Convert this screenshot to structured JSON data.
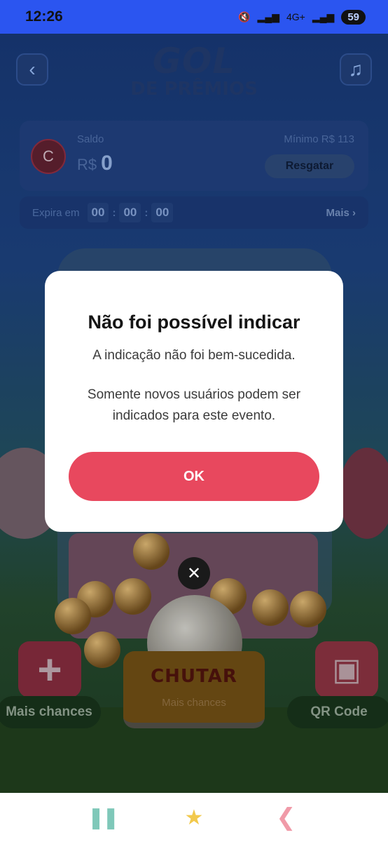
{
  "status_bar": {
    "time": "12:26",
    "network": "4G+",
    "battery": "59"
  },
  "game": {
    "title_line1": "GOL",
    "title_line2": "DE PRÊMIOS",
    "back_icon": "chevron-left-icon",
    "music_icon": "music-note-icon"
  },
  "balance": {
    "avatar_letter": "C",
    "label": "Saldo",
    "currency": "R$",
    "amount": "0",
    "minimum": "Mínimo  R$ 113",
    "redeem_label": "Resgatar"
  },
  "expiry": {
    "label": "Expira em",
    "hours": "00",
    "minutes": "00",
    "seconds": "00",
    "more_label": "Mais ›"
  },
  "actions": {
    "kick_label": "CHUTAR",
    "kick_sub": "Mais chances",
    "more_chances_label": "Mais chances",
    "qr_label": "QR Code"
  },
  "dialog": {
    "title": "Não foi possível indicar",
    "message1": "A indicação não foi bem-sucedida.",
    "message2": "Somente novos usuários podem ser indicados para este evento.",
    "ok_label": "OK",
    "close_glyph": "✕"
  },
  "nav": {
    "recent_glyph": "❚❚",
    "home_glyph": "★",
    "back_glyph": "❮"
  },
  "colors": {
    "accent": "#e8485e",
    "status_bar": "#2b55f0"
  }
}
